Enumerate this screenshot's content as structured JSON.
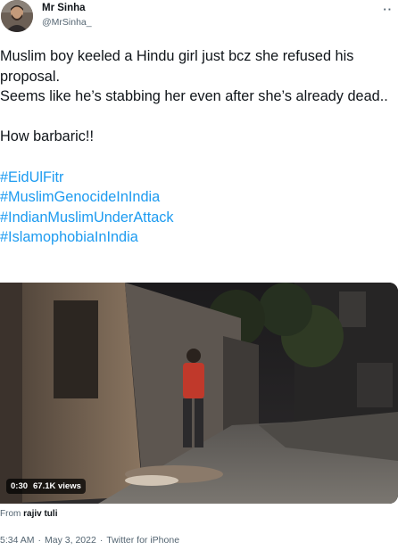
{
  "tweet": {
    "author_name": "Mr Sinha",
    "author_handle": "@MrSinha_",
    "more_icon": "more-horizontal-icon",
    "text_lines": [
      "Muslim boy keeled a Hindu girl just bcz she refused his proposal.",
      "Seems like he’s stabbing her even after she’s already dead..",
      "How barbaric!!"
    ],
    "hashtags": [
      "#EidUlFitr",
      "#MuslimGenocideInIndia",
      "#IndianMuslimUnderAttack",
      "#IslamophobiaInIndia"
    ],
    "video": {
      "duration": "0:30",
      "views": "67.1K views"
    },
    "from_prefix": "From",
    "from_source": "rajiv tuli",
    "time": "5:34 AM",
    "separator": "·",
    "date": "May 3, 2022",
    "client": "Twitter for iPhone"
  },
  "colors": {
    "link": "#1d9bf0",
    "secondary_text": "#536471",
    "primary_text": "#0f1419"
  }
}
